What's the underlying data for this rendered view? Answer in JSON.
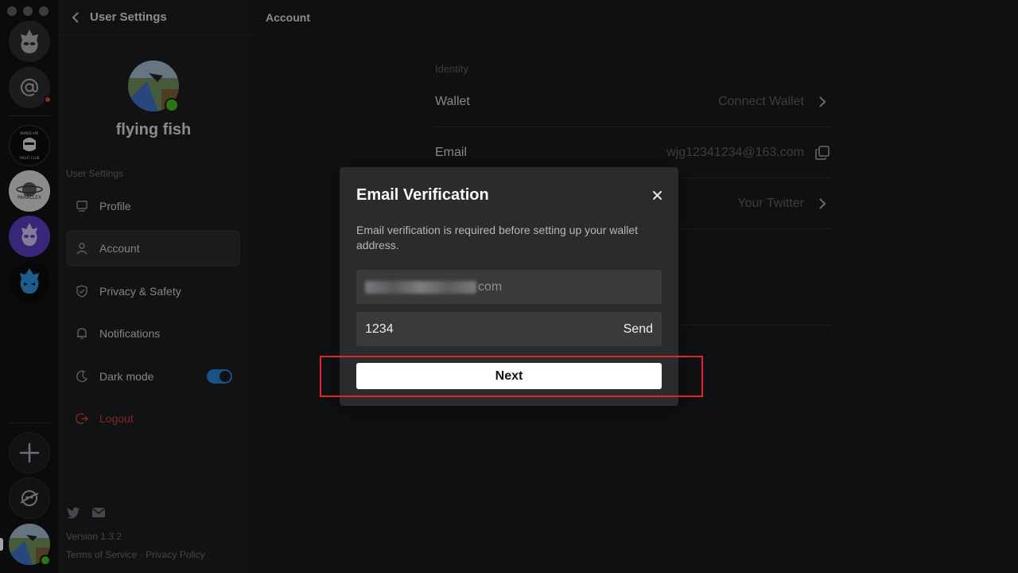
{
  "sidebar": {
    "header_title": "User Settings",
    "profile_name": "flying fish",
    "section_label": "User Settings",
    "items": [
      {
        "label": "Profile"
      },
      {
        "label": "Account"
      },
      {
        "label": "Privacy & Safety"
      },
      {
        "label": "Notifications"
      },
      {
        "label": "Dark mode",
        "toggle_on": true
      },
      {
        "label": "Logout"
      }
    ],
    "version": "Version 1.3.2",
    "legal": "Terms of Service · Privacy Policy"
  },
  "rail": {
    "servers": [
      "bored-ape-icon",
      "parallex-icon",
      "purple-alien-icon",
      "blue-robot-icon"
    ],
    "parallex_text": "PARALLEX"
  },
  "main": {
    "header_title": "Account",
    "identity_label": "Identity",
    "rows": [
      {
        "label": "Wallet",
        "value": "Connect Wallet",
        "icon": "chevron-right-icon"
      },
      {
        "label": "Email",
        "value": "wjg12341234@163.com",
        "icon": "copy-icon"
      },
      {
        "label": "",
        "value": "Your Twitter",
        "icon": "chevron-right-icon"
      }
    ]
  },
  "modal": {
    "title": "Email Verification",
    "description": "Email verification is required before setting up your wallet address.",
    "email_suffix": "com",
    "code_value": "1234",
    "send_label": "Send",
    "next_label": "Next"
  },
  "colors": {
    "accent_toggle": "#2b7fc9",
    "logout": "#c23b3b",
    "highlight": "#e0262b",
    "status_online": "#43b51f"
  }
}
